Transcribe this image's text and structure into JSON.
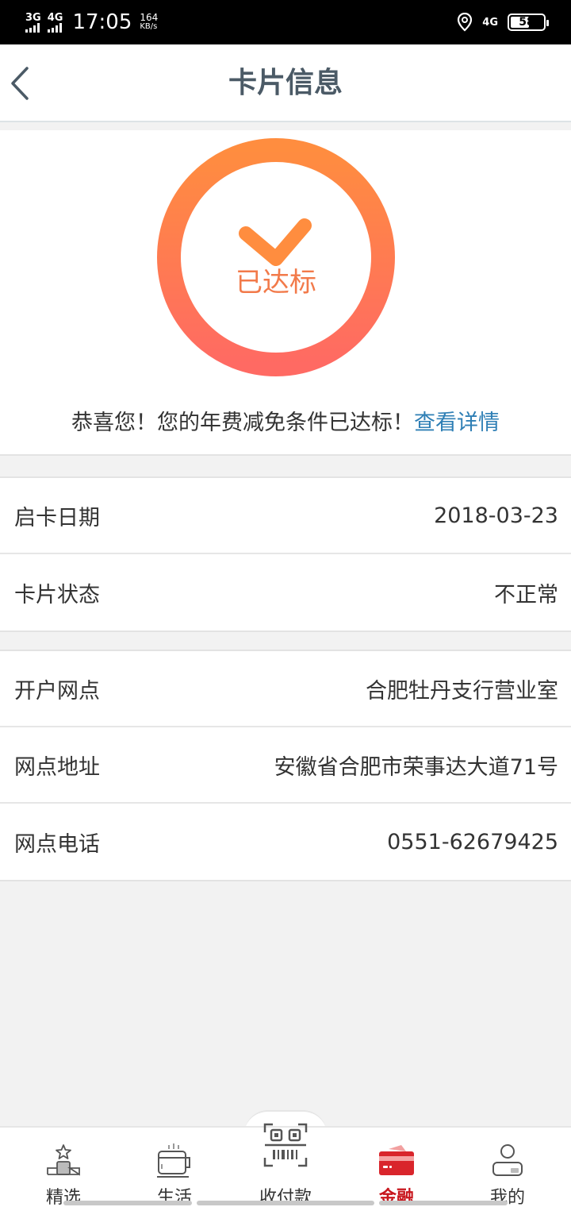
{
  "status_bar": {
    "sim1": "3G",
    "sim2": "4G",
    "time": "17:05",
    "speed_value": "164",
    "speed_unit": "KB/s",
    "network": "4G",
    "battery": "58",
    "battery_level": 0.58
  },
  "header": {
    "title": "卡片信息"
  },
  "status_card": {
    "badge_text": "已达标",
    "message": "恭喜您！您的年费减免条件已达标！",
    "link": "查看详情",
    "colors": {
      "ring_top": "#ff8d3f",
      "ring_bottom": "#ff6a63",
      "link": "#2f7fb5"
    }
  },
  "card_info": {
    "rows": [
      {
        "label": "启卡日期",
        "value": "2018-03-23"
      },
      {
        "label": "卡片状态",
        "value": "不正常"
      }
    ]
  },
  "branch_info": {
    "rows": [
      {
        "label": "开户网点",
        "value": "合肥牡丹支行营业室"
      },
      {
        "label": "网点地址",
        "value": "安徽省合肥市荣事达大道71号"
      },
      {
        "label": "网点电话",
        "value": "0551-62679425"
      }
    ]
  },
  "tabbar": {
    "tabs": [
      {
        "label": "精选",
        "icon": "star-podium-icon"
      },
      {
        "label": "生活",
        "icon": "coffee-cup-icon"
      },
      {
        "label": "收付款",
        "icon": "scan-qr-icon"
      },
      {
        "label": "金融",
        "icon": "bank-card-icon",
        "active": true
      },
      {
        "label": "我的",
        "icon": "user-icon"
      }
    ],
    "active_color": "#c8161d"
  }
}
